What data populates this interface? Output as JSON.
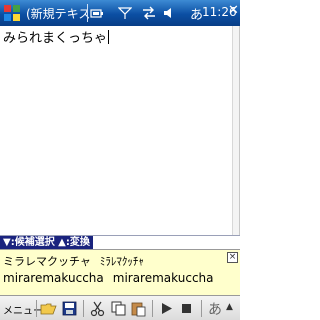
{
  "titlebar": {
    "title": "(新規テキス",
    "ime_mode": "あ",
    "time": "11:26",
    "close": "✕"
  },
  "editor": {
    "text": "みられまくっちゃ"
  },
  "hint": {
    "text": "▼:候補選択  ▲:変換"
  },
  "candidates": {
    "row1": [
      "ミラレマクッチャ",
      "ﾐﾗﾚﾏｸｯﾁｬ"
    ],
    "row2": [
      "miraremakuccha",
      "miraremakuccha"
    ],
    "close": "×"
  },
  "toolbar": {
    "menu_label": "メニュー",
    "ime_label": "あ",
    "ime_arrow": "▲"
  },
  "colors": {
    "titlebar": "#0b4fa3",
    "hint_bg": "#1a237e",
    "candidate_bg": "#ffffcc"
  }
}
